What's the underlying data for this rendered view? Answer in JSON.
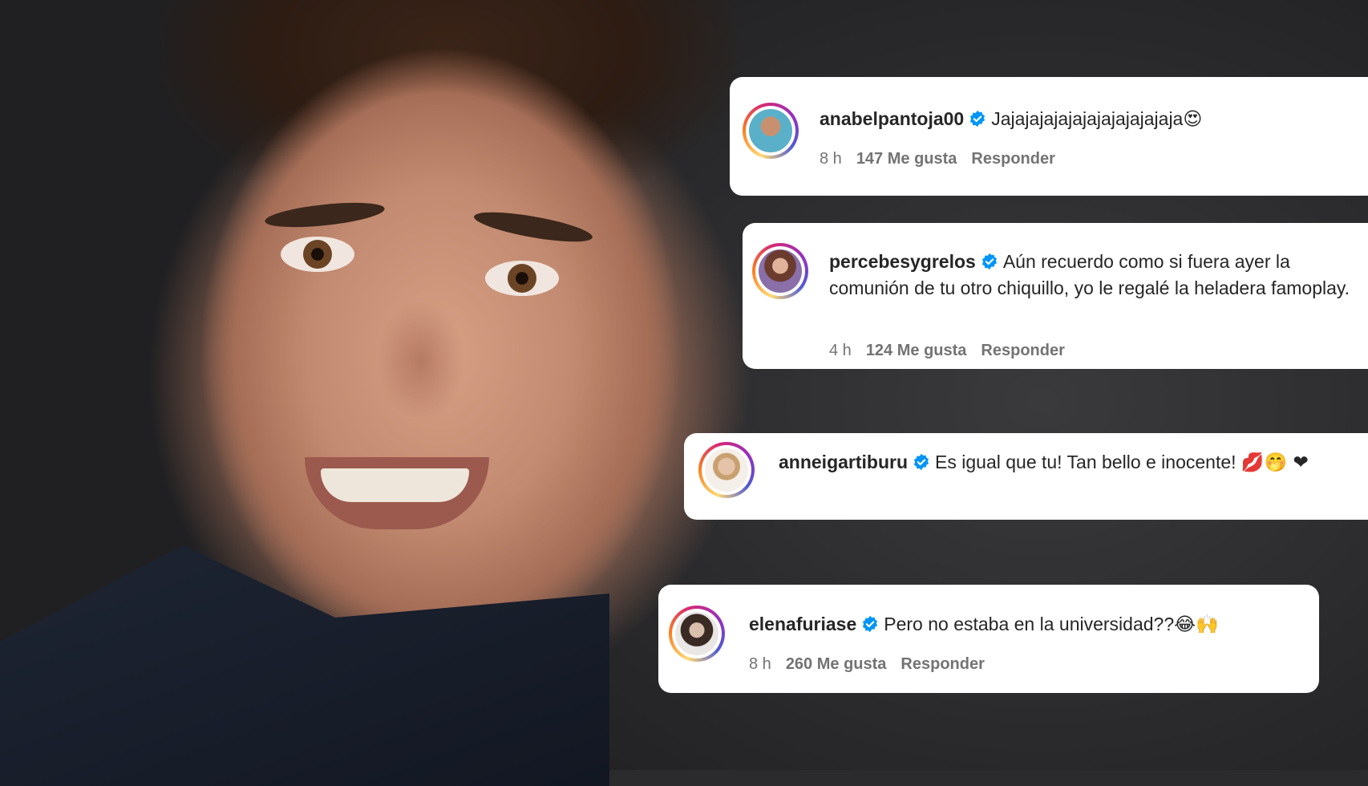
{
  "comments": [
    {
      "username": "anabelpantoja00",
      "text": "Jajajajajajajajajajajajaja",
      "emojis": "😍",
      "time": "8 h",
      "likes": "147 Me gusta",
      "reply": "Responder"
    },
    {
      "username": "percebesygrelos",
      "text": "Aún recuerdo como si fuera ayer la comunión de tu otro chiquillo, yo le regalé la heladera famoplay.",
      "emojis": "",
      "time": "4 h",
      "likes": "124 Me gusta",
      "reply": "Responder"
    },
    {
      "username": "anneigartiburu",
      "text": "Es igual que tu! Tan bello e inocente!",
      "emojis": "💋🤭 ❤",
      "time": "",
      "likes": "",
      "reply": ""
    },
    {
      "username": "elenafuriase",
      "text": "Pero no estaba en la universidad??",
      "emojis": "😂🙌",
      "time": "8 h",
      "likes": "260 Me gusta",
      "reply": "Responder"
    }
  ],
  "icons": {
    "verified": "verified-badge-icon",
    "avatar_ring": "instagram-story-ring"
  },
  "colors": {
    "verified_blue": "#0095f6",
    "meta_gray": "#737373",
    "text": "#262626"
  }
}
